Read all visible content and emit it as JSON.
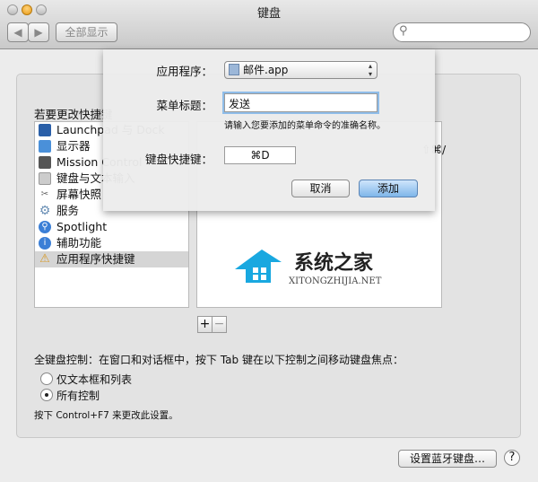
{
  "window": {
    "title": "键盘",
    "show_all": "全部显示",
    "search_placeholder": ""
  },
  "main": {
    "instruction": "若要更改快捷键",
    "categories": [
      {
        "label": "Launchpad 与 Dock",
        "icon": "launchpad-icon"
      },
      {
        "label": "显示器",
        "icon": "display-icon"
      },
      {
        "label": "Mission Control",
        "icon": "mission-control-icon"
      },
      {
        "label": "键盘与文本输入",
        "icon": "keyboard-icon"
      },
      {
        "label": "屏幕快照",
        "icon": "screenshot-icon"
      },
      {
        "label": "服务",
        "icon": "gear-icon"
      },
      {
        "label": "Spotlight",
        "icon": "spotlight-icon"
      },
      {
        "label": "辅助功能",
        "icon": "accessibility-icon"
      },
      {
        "label": "应用程序快捷键",
        "icon": "app-shortcuts-icon",
        "selected": true
      }
    ],
    "shortcut_row": {
      "keys": "⇧⌘/"
    },
    "add_label": "+",
    "remove_label": "−",
    "full_keyboard_access": "全键盘控制：在窗口和对话框中，按下 Tab 键在以下控制之间移动键盘焦点：",
    "radio_options": [
      {
        "label": "仅文本框和列表",
        "selected": false
      },
      {
        "label": "所有控制",
        "selected": true
      }
    ],
    "note": "按下 Control+F7 来更改此设置。",
    "bluetooth_button": "设置蓝牙键盘…",
    "help_label": "?"
  },
  "sheet": {
    "app_label": "应用程序：",
    "app_value": "邮件.app",
    "menu_title_label": "菜单标题：",
    "menu_title_value": "发送",
    "hint": "请输入您要添加的菜单命令的准确名称。",
    "shortcut_label": "键盘快捷键：",
    "shortcut_value": "⌘D",
    "cancel": "取消",
    "add": "添加"
  },
  "watermark": {
    "name": "系统之家",
    "url": "XITONGZHIJIA.NET"
  },
  "colors": {
    "accent": "#7fb6ea",
    "logo": "#19a8e0"
  }
}
